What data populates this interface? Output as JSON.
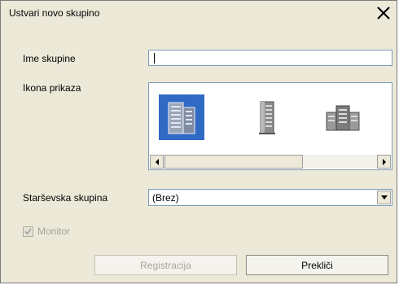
{
  "window": {
    "title": "Ustvari novo skupino"
  },
  "form": {
    "name_label": "Ime skupine",
    "name_value": "",
    "icon_label": "Ikona prikaza",
    "icons": [
      {
        "name": "building-tall-selected-icon",
        "selected": true
      },
      {
        "name": "building-tower-icon",
        "selected": false
      },
      {
        "name": "building-complex-icon",
        "selected": false
      }
    ],
    "parent_label": "Starševska skupina",
    "parent_value": "(Brez)",
    "monitor_label": "Monitor",
    "monitor_checked": true
  },
  "buttons": {
    "register": "Registracija",
    "cancel": "Prekliči"
  },
  "colors": {
    "selection": "#316ac5",
    "face": "#ece9d8",
    "field_border": "#7f9db9"
  }
}
